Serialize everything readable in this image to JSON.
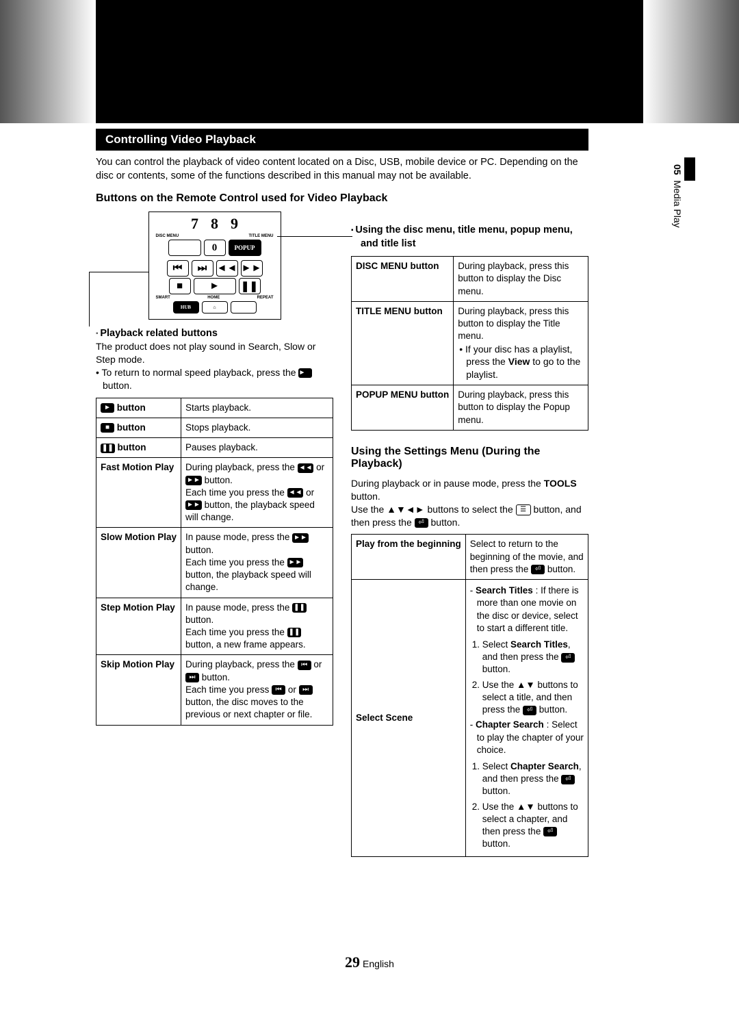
{
  "chapter_side": {
    "num": "05",
    "title": "Media Play"
  },
  "section_bar": "Controlling Video Playback",
  "intro": "You can control the playback of video content located on a Disc, USB, mobile device or PC. Depending on the disc or contents, some of the functions described in this manual may not be available.",
  "subhead_remote": "Buttons on the Remote Control used for Video Playback",
  "remote": {
    "row_nums": [
      "7",
      "8",
      "9"
    ],
    "label_left": "DISC MENU",
    "label_right": "TITLE MENU",
    "zero": "0",
    "popup": "POPUP",
    "hub": "HUB",
    "smart": "SMART",
    "home": "HOME",
    "repeat": "REPEAT"
  },
  "left": {
    "playback_sub": "Playback related buttons",
    "para1": "The product does not play sound in Search, Slow or Step mode.",
    "bullet1_a": "To return to normal speed playback, press the ",
    "bullet1_b": " button.",
    "table": [
      {
        "label_icon": "play",
        "label_suffix": " button",
        "desc": "Starts playback."
      },
      {
        "label_icon": "stop",
        "label_suffix": " button",
        "desc": "Stops playback."
      },
      {
        "label_icon": "pause",
        "label_suffix": " button",
        "desc": "Pauses playback."
      },
      {
        "label_text": "Fast Motion Play",
        "desc_parts": [
          "During playback, press the ",
          " or ",
          " button.",
          "Each time you press the ",
          " or ",
          " button, the playback speed will change."
        ]
      },
      {
        "label_text": "Slow Motion Play",
        "desc_parts": [
          "In pause mode, press the ",
          " button.",
          "Each time you press the ",
          " button, the playback speed will change."
        ]
      },
      {
        "label_text": "Step Motion Play",
        "desc_parts": [
          "In pause mode, press the ",
          " button.",
          "Each time you press the ",
          " button, a new frame appears."
        ]
      },
      {
        "label_text": "Skip Motion Play",
        "desc_parts": [
          "During playback, press the ",
          " or ",
          " button.",
          "Each time you press ",
          " or ",
          " button, the disc moves to the previous or next chapter or file."
        ]
      }
    ]
  },
  "right": {
    "sub1": "Using the disc menu, title menu, popup menu, and title list",
    "menu_table": [
      {
        "label": "DISC MENU button",
        "desc": "During playback, press this button to display the Disc menu."
      },
      {
        "label": "TITLE MENU button",
        "desc_a": "During playback, press this button to display the Title menu.",
        "bullet": "If your disc has a playlist, press the ",
        "bullet_bold": "View",
        "bullet_b": " to go to the playlist."
      },
      {
        "label": "POPUP MENU button",
        "desc": "During playback, press this button to display the Popup menu."
      }
    ],
    "settings_head": "Using the Settings Menu (During the Playback)",
    "settings_p1_a": "During playback or in pause mode, press the ",
    "settings_p1_bold": "TOOLS",
    "settings_p1_b": " button.",
    "settings_p2_a": "Use the ▲▼◄► buttons to select the ",
    "settings_p2_b": " button, and then press the ",
    "settings_p2_c": " button.",
    "settings_table": {
      "row1_label": "Play from the beginning",
      "row1_desc_a": "Select to return to the beginning of the movie, and then press the ",
      "row1_desc_b": " button.",
      "row2_label": "Select Scene",
      "row2": {
        "dash1_bold": "Search Titles",
        "dash1_rest": " : If there is more than one movie on the disc or device, select to start a different title.",
        "ol1_1_a": "Select ",
        "ol1_1_bold": "Search Titles",
        "ol1_1_b": ", and then press the ",
        "ol1_1_c": " button.",
        "ol1_2_a": "Use the ▲▼ buttons to select a title, and then press the ",
        "ol1_2_b": " button.",
        "dash2_bold": "Chapter Search",
        "dash2_rest": " : Select to play the chapter of your choice.",
        "ol2_1_a": "Select ",
        "ol2_1_bold": "Chapter Search",
        "ol2_1_b": ", and then press the ",
        "ol2_1_c": " button.",
        "ol2_2_a": "Use the ▲▼ buttons to select a chapter, and then press the ",
        "ol2_2_b": " button."
      }
    }
  },
  "footer": {
    "page": "29",
    "lang": "English"
  }
}
